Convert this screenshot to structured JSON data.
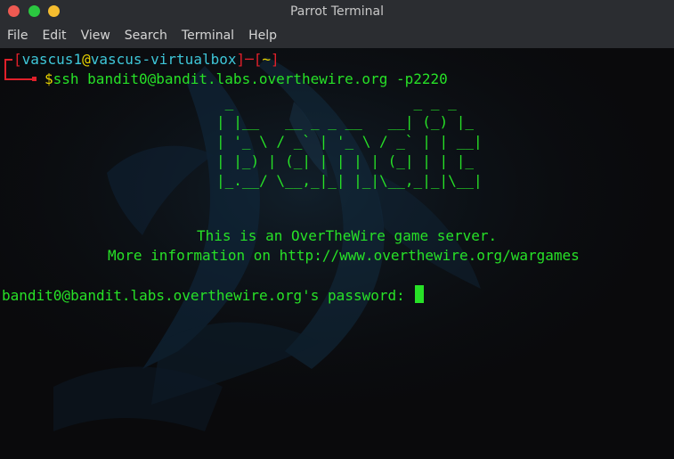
{
  "window": {
    "title": "Parrot Terminal"
  },
  "menu": {
    "items": [
      "File",
      "Edit",
      "View",
      "Search",
      "Terminal",
      "Help"
    ]
  },
  "prompt": {
    "open_bracket": "[",
    "user": "vascus1",
    "at": "@",
    "host": "vascus-virtualbox",
    "close_bracket": "]",
    "separator": "─",
    "dir_open": "[",
    "dir": "~",
    "dir_close": "]",
    "dollar": "$",
    "command": "ssh bandit0@bandit.labs.overthewire.org -p2220"
  },
  "banner": {
    "ascii": [
      " _                     _ _ _   ",
      "| |__   __ _ _ __   __| (_) |_ ",
      "| '_ \\ / _` | '_ \\ / _` | | __|",
      "| |_) | (_| | | | | (_| | | |_ ",
      "|_.__/ \\__,_|_| |_|\\__,_|_|\\__|"
    ],
    "line1": "This is an OverTheWire game server.",
    "line2": "More information on http://www.overthewire.org/wargames"
  },
  "password_prompt": "bandit0@bandit.labs.overthewire.org's password: ",
  "colors": {
    "prompt_bracket": "#e0202a",
    "user": "#3ec6d8",
    "at": "#e8d300",
    "host": "#3ec6d8",
    "output": "#27e127",
    "background": "#0a0a0c",
    "titlebar": "#2b2d31"
  }
}
